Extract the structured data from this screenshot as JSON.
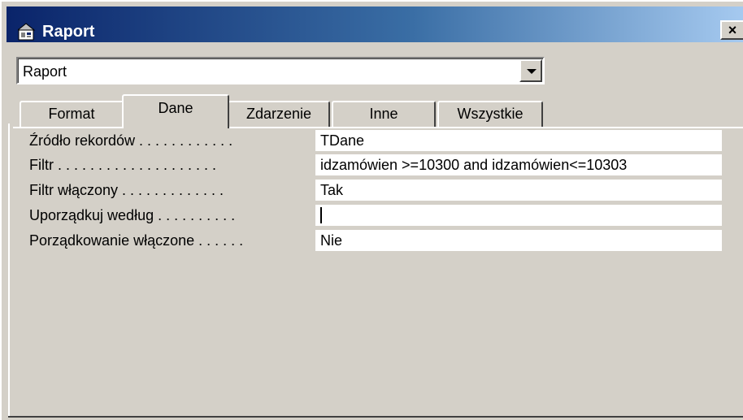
{
  "window": {
    "title": "Raport",
    "icon": "properties-sheet-icon",
    "close_label": "×"
  },
  "selector": {
    "value": "Raport",
    "icon": "chevron-down-icon"
  },
  "tabs": [
    {
      "label": "Format",
      "active": false
    },
    {
      "label": "Dane",
      "active": true
    },
    {
      "label": "Zdarzenie",
      "active": false
    },
    {
      "label": "Inne",
      "active": false
    },
    {
      "label": "Wszystkie",
      "active": false
    }
  ],
  "properties": [
    {
      "label": "Źródło rekordów . . . . . . . . . . . .",
      "value": "TDane"
    },
    {
      "label": "Filtr . . . . . . . . . . . . . . . . . . . .",
      "value": "idzamówien >=10300 and idzamówien<=10303"
    },
    {
      "label": "Filtr włączony . . . . . . . . . . . . .",
      "value": "Tak"
    },
    {
      "label": "Uporządkuj według . . . . . . . . . .",
      "value": ""
    },
    {
      "label": "Porządkowanie włączone . . . . . .",
      "value": "Nie"
    }
  ]
}
